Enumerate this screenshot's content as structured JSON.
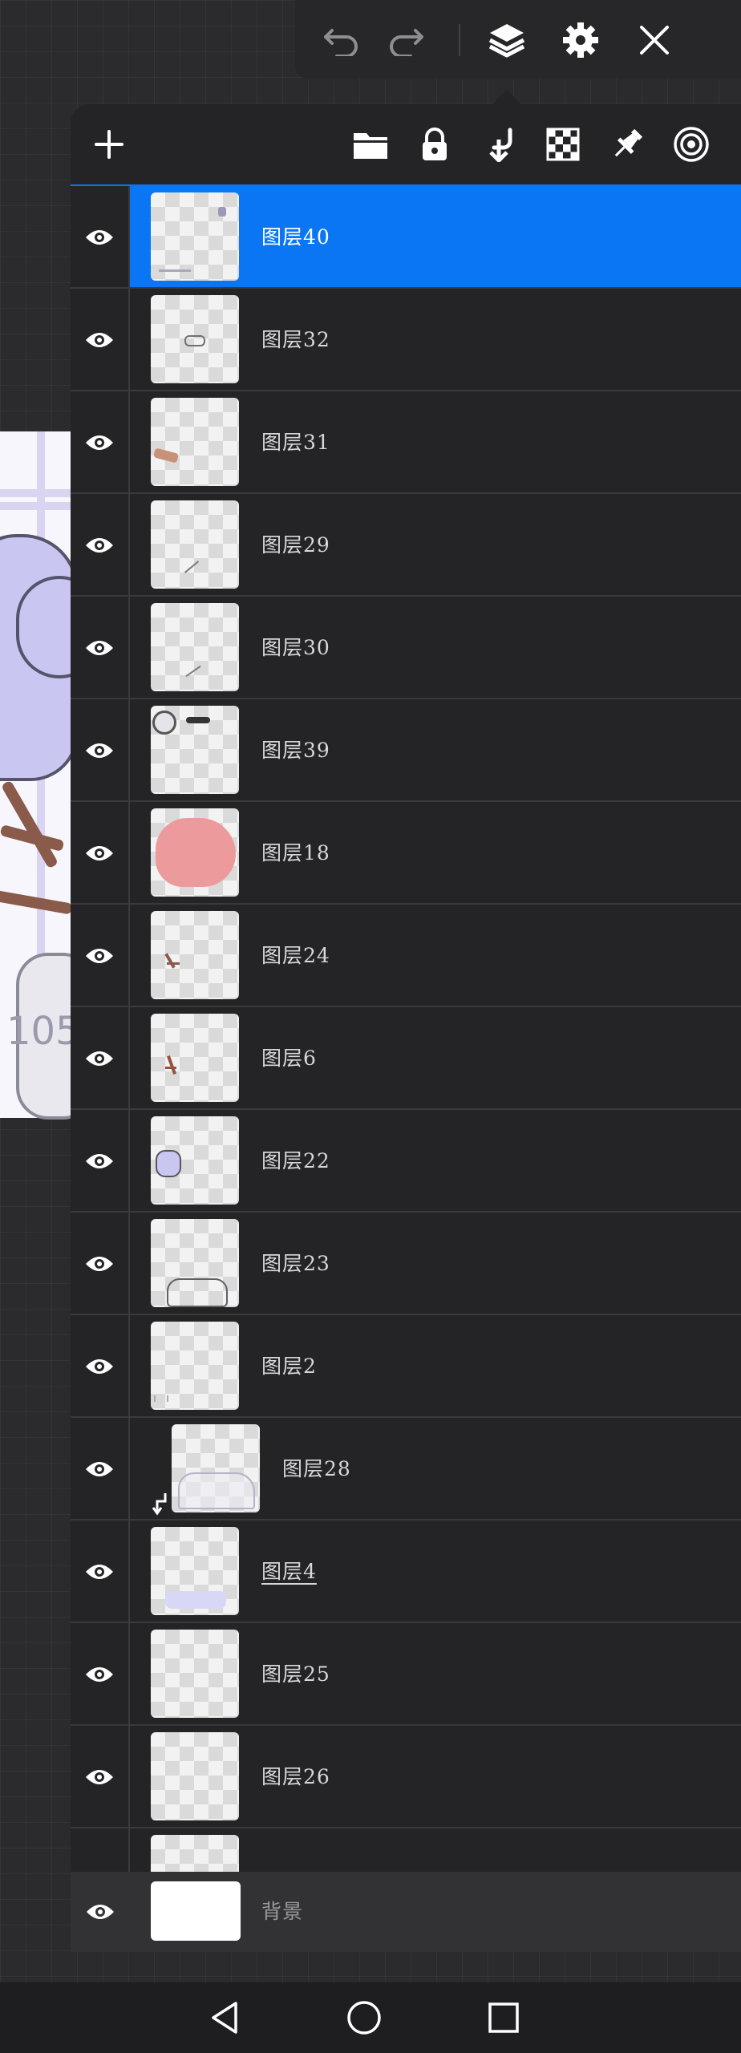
{
  "toolbar": {
    "icons": [
      "undo-icon",
      "redo-icon",
      "layers-icon",
      "gear-icon",
      "close-icon"
    ]
  },
  "panel_header": {
    "icons": [
      "add-icon",
      "folder-icon",
      "lock-icon",
      "merge-down-icon",
      "checker-icon",
      "pin-icon",
      "target-icon"
    ]
  },
  "layers": [
    {
      "name": "图层40",
      "selected": true
    },
    {
      "name": "图层32"
    },
    {
      "name": "图层31"
    },
    {
      "name": "图层29"
    },
    {
      "name": "图层30"
    },
    {
      "name": "图层39"
    },
    {
      "name": "图层18"
    },
    {
      "name": "图层24"
    },
    {
      "name": "图层6"
    },
    {
      "name": "图层22"
    },
    {
      "name": "图层23"
    },
    {
      "name": "图层2"
    },
    {
      "name": "图层28",
      "clipped": true
    },
    {
      "name": "图层4",
      "underlined": true
    },
    {
      "name": "图层25"
    },
    {
      "name": "图层26"
    }
  ],
  "background_layer": {
    "name": "背景"
  },
  "canvas_watermark": "105",
  "colors": {
    "accent": "#0a76f4",
    "panel": "#242426",
    "app_bg": "#2b2b2d"
  },
  "system_nav": {
    "icons": [
      "back-icon",
      "home-icon",
      "recents-icon"
    ]
  }
}
